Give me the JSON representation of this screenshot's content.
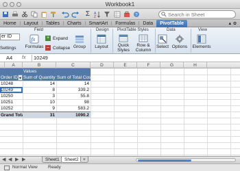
{
  "window": {
    "title": "Workbook1"
  },
  "search": {
    "placeholder": "Search in Sheet"
  },
  "toolbar": {
    "zoom_value": "100%"
  },
  "ribbon_tabs": [
    "Home",
    "Layout",
    "Tables",
    "Charts",
    "SmartArt",
    "Formulas",
    "Data",
    "PivotTable"
  ],
  "ribbon_active_tab": "PivotTable",
  "groups": {
    "field": {
      "title": "Field",
      "input_value": "er ID",
      "settings_label": "Settings",
      "formulas_label": "Formulas",
      "expand_label": "Expand",
      "collapse_label": "Collapse",
      "group_label": "Group"
    },
    "design": {
      "title": "Design",
      "layout_label": "Layout"
    },
    "styles": {
      "title": "PivotTable Styles",
      "quick_styles_label": "Quick Styles",
      "row_col_label": "Row & Column"
    },
    "data": {
      "title": "Data",
      "select_label": "Select",
      "options_label": "Options"
    },
    "view": {
      "title": "View",
      "elements_label": "Elements"
    }
  },
  "formula_bar": {
    "cell_ref": "A4",
    "fx": "fx",
    "value": "10249"
  },
  "columns": [
    "A",
    "B",
    "C",
    "D",
    "E",
    "F",
    "G",
    "H"
  ],
  "pivot": {
    "values_label": "Values",
    "col_a_header": "Order ID",
    "col_b_header": "Sum of Quantity",
    "col_c_header": "Sum of Total Cost",
    "rows": [
      {
        "id": "10248",
        "qty": "14",
        "cost": "14"
      },
      {
        "id": "10249",
        "qty": "8",
        "cost": "339.2"
      },
      {
        "id": "10250",
        "qty": "3",
        "cost": "55.8"
      },
      {
        "id": "10251",
        "qty": "10",
        "cost": "98"
      },
      {
        "id": "10252",
        "qty": "9",
        "cost": "583.2"
      }
    ],
    "total_label": "Grand Total",
    "total_qty": "31",
    "total_cost": "1090.2"
  },
  "sheets": [
    "Sheet1",
    "Sheet2"
  ],
  "active_sheet": "Sheet2",
  "status": {
    "view": "Normal View",
    "state": "Ready"
  }
}
